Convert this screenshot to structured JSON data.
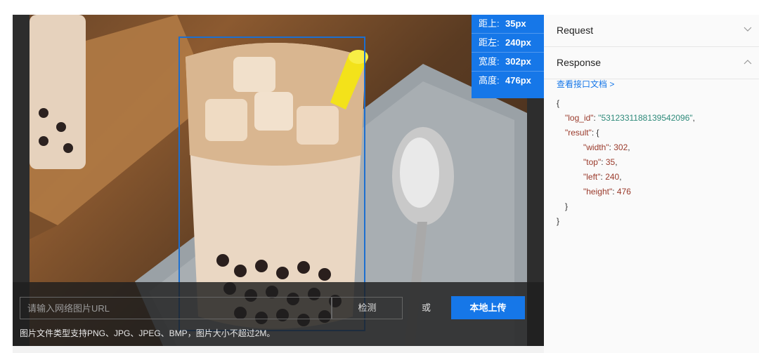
{
  "overlay": {
    "rows": [
      {
        "label": "距上:",
        "value": "35px"
      },
      {
        "label": "距左:",
        "value": "240px"
      },
      {
        "label": "宽度:",
        "value": "302px"
      },
      {
        "label": "高度:",
        "value": "476px"
      }
    ]
  },
  "upload": {
    "url_placeholder": "请输入网络图片URL",
    "detect_label": "检测",
    "or_label": "或",
    "local_upload_label": "本地上传",
    "hint": "图片文件类型支持PNG、JPG、JPEG、BMP，图片大小不超过2M。"
  },
  "panel": {
    "request_title": "Request",
    "response_title": "Response",
    "doc_link": "查看接口文档 >",
    "json": {
      "open": "{",
      "log_id_key": "\"log_id\"",
      "log_id_value": "\"5312331188139542096\"",
      "result_key": "\"result\"",
      "result_open": "{",
      "width_key": "\"width\"",
      "width_value": "302",
      "top_key": "\"top\"",
      "top_value": "35",
      "left_key": "\"left\"",
      "left_value": "240",
      "height_key": "\"height\"",
      "height_value": "476",
      "result_close": "}",
      "close": "}"
    }
  }
}
